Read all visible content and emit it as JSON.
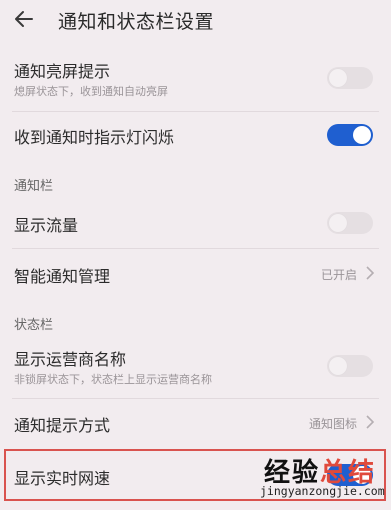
{
  "header": {
    "title": "通知和状态栏设置",
    "back_icon": "back-arrow-icon"
  },
  "rows": {
    "screen_wake": {
      "title": "通知亮屏提示",
      "subtitle": "熄屏状态下，收到通知自动亮屏",
      "enabled": false
    },
    "indicator_light": {
      "title": "收到通知时指示灯闪烁",
      "enabled": true
    },
    "show_traffic": {
      "title": "显示流量",
      "enabled": false
    },
    "smart_notify": {
      "title": "智能通知管理",
      "value": "已开启"
    },
    "carrier_name": {
      "title": "显示运营商名称",
      "subtitle": "非锁屏状态下，状态栏上显示运营商名称",
      "enabled": false
    },
    "notify_style": {
      "title": "通知提示方式",
      "value": "通知图标"
    },
    "realtime_speed": {
      "title": "显示实时网速",
      "enabled": true
    }
  },
  "sections": {
    "notification_bar": "通知栏",
    "status_bar": "状态栏"
  },
  "watermark": {
    "main_prefix": "经验",
    "main_suffix": "总结",
    "url": "jingyanzongjie.com"
  },
  "colors": {
    "accent": "#1f5fd0",
    "highlight": "#d9534f",
    "background": "#f2ecef"
  }
}
